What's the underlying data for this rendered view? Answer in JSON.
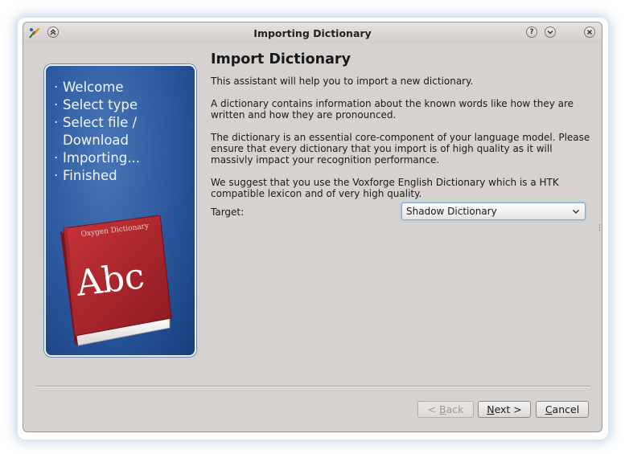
{
  "window": {
    "title": "Importing Dictionary",
    "icons": [
      "app-icon",
      "keep-above-icon",
      "help-icon",
      "minimize-icon",
      "close-icon"
    ],
    "help_glyph": "?"
  },
  "steps": [
    {
      "bullet": "·",
      "label": "Welcome"
    },
    {
      "bullet": "·",
      "label": "Select type"
    },
    {
      "bullet": "·",
      "label": "Select file / Download"
    },
    {
      "bullet": "·",
      "label": "Importing..."
    },
    {
      "bullet": "·",
      "label": "Finished"
    }
  ],
  "book": {
    "cover_title": "Oxygen Dictionary",
    "cover_text": "Abc"
  },
  "page": {
    "heading": "Import Dictionary",
    "paragraphs": [
      "This assistant will help you to import a new dictionary.",
      "A dictionary contains information about the known words like how they are written and how they are pronounced.",
      "The dictionary is an essential core-component of your language model. Please ensure that every dictionary that you import is of high quality as it will massivly impact your recognition performance.",
      "We suggest that you use the Voxforge English Dictionary which is a HTK compatible lexicon and of very high quality."
    ],
    "target_label": "Target:",
    "target_value": "Shadow Dictionary"
  },
  "buttons": {
    "back_prefix": "< ",
    "back_mnemonic": "B",
    "back_rest": "ack",
    "next_mnemonic": "N",
    "next_rest": "ext >",
    "cancel_mnemonic": "C",
    "cancel_rest": "ancel"
  },
  "colors": {
    "panel_blue": "#2d5aa0",
    "book_red": "#b0242a",
    "window_bg": "#d6d2d0",
    "focus_blue": "#7fa7d8"
  }
}
